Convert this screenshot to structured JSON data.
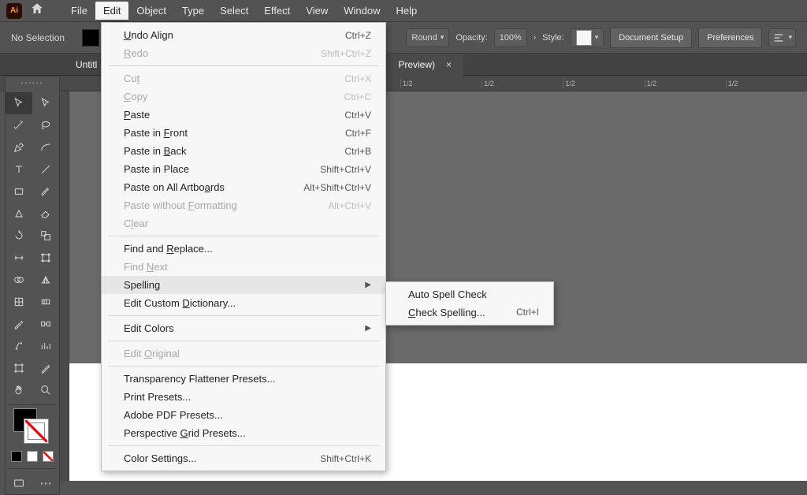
{
  "menubar": {
    "app": "Ai",
    "items": [
      "File",
      "Edit",
      "Object",
      "Type",
      "Select",
      "Effect",
      "View",
      "Window",
      "Help"
    ],
    "open_index": 1
  },
  "controlbar": {
    "selection_label": "No Selection",
    "cap_value": "Round",
    "opacity_label": "Opacity:",
    "opacity_value": "100%",
    "style_label": "Style:",
    "doc_setup": "Document Setup",
    "preferences": "Preferences"
  },
  "doc_tab": {
    "left_bit": "Untitl",
    "label": "Preview)",
    "close": "×"
  },
  "ruler": {
    "ticks": [
      "1/2",
      "1/2",
      "1/2",
      "1/2",
      "1/2"
    ]
  },
  "edit_menu": [
    {
      "label": "Undo Align",
      "shortcut": "Ctrl+Z",
      "disabled": false,
      "u": 0
    },
    {
      "label": "Redo",
      "shortcut": "Shift+Ctrl+Z",
      "disabled": true,
      "u": 0
    },
    {
      "sep": true
    },
    {
      "label": "Cut",
      "shortcut": "Ctrl+X",
      "disabled": true,
      "u": 2
    },
    {
      "label": "Copy",
      "shortcut": "Ctrl+C",
      "disabled": true,
      "u": 0
    },
    {
      "label": "Paste",
      "shortcut": "Ctrl+V",
      "disabled": false,
      "u": 0
    },
    {
      "label": "Paste in Front",
      "shortcut": "Ctrl+F",
      "disabled": false,
      "u": 9
    },
    {
      "label": "Paste in Back",
      "shortcut": "Ctrl+B",
      "disabled": false,
      "u": 9
    },
    {
      "label": "Paste in Place",
      "shortcut": "Shift+Ctrl+V",
      "disabled": false
    },
    {
      "label": "Paste on All Artboards",
      "shortcut": "Alt+Shift+Ctrl+V",
      "disabled": false,
      "u": 18
    },
    {
      "label": "Paste without Formatting",
      "shortcut": "Alt+Ctrl+V",
      "disabled": true,
      "u": 14
    },
    {
      "label": "Clear",
      "shortcut": "",
      "disabled": true,
      "u": 1
    },
    {
      "sep": true
    },
    {
      "label": "Find and Replace...",
      "shortcut": "",
      "disabled": false,
      "u": 9
    },
    {
      "label": "Find Next",
      "shortcut": "",
      "disabled": true,
      "u": 5
    },
    {
      "label": "Spelling",
      "shortcut": "",
      "submenu": true,
      "hover": true
    },
    {
      "label": "Edit Custom Dictionary...",
      "shortcut": "",
      "disabled": false,
      "u": 12
    },
    {
      "sep": true
    },
    {
      "label": "Edit Colors",
      "shortcut": "",
      "submenu": true
    },
    {
      "sep": true
    },
    {
      "label": "Edit Original",
      "shortcut": "",
      "disabled": true,
      "u": 5
    },
    {
      "sep": true
    },
    {
      "label": "Transparency Flattener Presets...",
      "shortcut": ""
    },
    {
      "label": "Print Presets...",
      "shortcut": ""
    },
    {
      "label": "Adobe PDF Presets...",
      "shortcut": ""
    },
    {
      "label": "Perspective Grid Presets...",
      "shortcut": "",
      "u": 12
    },
    {
      "sep": true
    },
    {
      "label": "Color Settings...",
      "shortcut": "Shift+Ctrl+K",
      "u": 12
    }
  ],
  "spelling_submenu": [
    {
      "label": "Auto Spell Check",
      "shortcut": ""
    },
    {
      "label": "Check Spelling...",
      "shortcut": "Ctrl+I",
      "u": 0
    }
  ],
  "tool_names": [
    [
      "selection-tool",
      "direct-selection-tool"
    ],
    [
      "magic-wand-tool",
      "lasso-tool"
    ],
    [
      "pen-tool",
      "curvature-tool"
    ],
    [
      "type-tool",
      "line-segment-tool"
    ],
    [
      "rectangle-tool",
      "paintbrush-tool"
    ],
    [
      "shaper-tool",
      "eraser-tool"
    ],
    [
      "rotate-tool",
      "scale-tool"
    ],
    [
      "width-tool",
      "free-transform-tool"
    ],
    [
      "shape-builder-tool",
      "perspective-grid-tool"
    ],
    [
      "mesh-tool",
      "gradient-tool"
    ],
    [
      "eyedropper-tool",
      "blend-tool"
    ],
    [
      "symbol-sprayer-tool",
      "column-graph-tool"
    ],
    [
      "artboard-tool",
      "slice-tool"
    ],
    [
      "hand-tool",
      "zoom-tool"
    ]
  ]
}
